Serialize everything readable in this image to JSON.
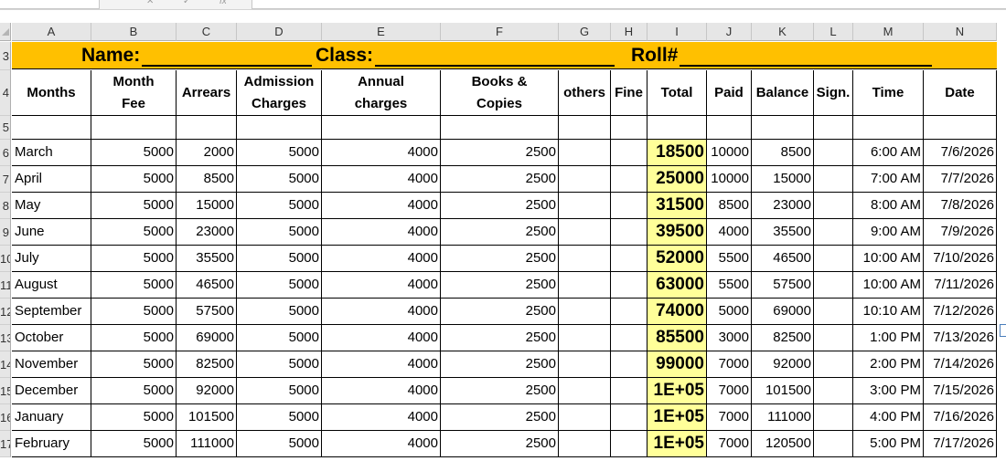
{
  "columns": [
    "A",
    "B",
    "C",
    "D",
    "E",
    "F",
    "G",
    "H",
    "I",
    "J",
    "K",
    "L",
    "M",
    "N"
  ],
  "row_numbers": [
    "3",
    "4",
    "5",
    "6",
    "7",
    "8",
    "9",
    "10",
    "11",
    "12",
    "13",
    "14",
    "15",
    "16",
    "17"
  ],
  "banner": {
    "name_label": "Name:",
    "class_label": "Class:",
    "roll_label": "Roll#"
  },
  "headers": {
    "months": "Months",
    "month_fee_1": "Month",
    "month_fee_2": "Fee",
    "arrears": "Arrears",
    "admission_1": "Admission",
    "admission_2": "Charges",
    "annual_1": "Annual",
    "annual_2": "charges",
    "books_1": "Books &",
    "books_2": "Copies",
    "others": "others",
    "fine": "Fine",
    "total": "Total",
    "paid": "Paid",
    "balance": "Balance",
    "sign": "Sign.",
    "time": "Time",
    "date": "Date"
  },
  "rows": [
    {
      "month": "March",
      "fee": "5000",
      "arrears": "2000",
      "admission": "5000",
      "annual": "4000",
      "books": "2500",
      "others": "",
      "fine": "",
      "total": "18500",
      "paid": "10000",
      "balance": "8500",
      "sign": "",
      "time": "6:00 AM",
      "date": "7/6/2026"
    },
    {
      "month": "April",
      "fee": "5000",
      "arrears": "8500",
      "admission": "5000",
      "annual": "4000",
      "books": "2500",
      "others": "",
      "fine": "",
      "total": "25000",
      "paid": "10000",
      "balance": "15000",
      "sign": "",
      "time": "7:00 AM",
      "date": "7/7/2026"
    },
    {
      "month": "May",
      "fee": "5000",
      "arrears": "15000",
      "admission": "5000",
      "annual": "4000",
      "books": "2500",
      "others": "",
      "fine": "",
      "total": "31500",
      "paid": "8500",
      "balance": "23000",
      "sign": "",
      "time": "8:00 AM",
      "date": "7/8/2026"
    },
    {
      "month": "June",
      "fee": "5000",
      "arrears": "23000",
      "admission": "5000",
      "annual": "4000",
      "books": "2500",
      "others": "",
      "fine": "",
      "total": "39500",
      "paid": "4000",
      "balance": "35500",
      "sign": "",
      "time": "9:00 AM",
      "date": "7/9/2026"
    },
    {
      "month": "July",
      "fee": "5000",
      "arrears": "35500",
      "admission": "5000",
      "annual": "4000",
      "books": "2500",
      "others": "",
      "fine": "",
      "total": "52000",
      "paid": "5500",
      "balance": "46500",
      "sign": "",
      "time": "10:00 AM",
      "date": "7/10/2026"
    },
    {
      "month": "August",
      "fee": "5000",
      "arrears": "46500",
      "admission": "5000",
      "annual": "4000",
      "books": "2500",
      "others": "",
      "fine": "",
      "total": "63000",
      "paid": "5500",
      "balance": "57500",
      "sign": "",
      "time": "10:00 AM",
      "date": "7/11/2026"
    },
    {
      "month": "September",
      "fee": "5000",
      "arrears": "57500",
      "admission": "5000",
      "annual": "4000",
      "books": "2500",
      "others": "",
      "fine": "",
      "total": "74000",
      "paid": "5000",
      "balance": "69000",
      "sign": "",
      "time": "10:10 AM",
      "date": "7/12/2026"
    },
    {
      "month": "October",
      "fee": "5000",
      "arrears": "69000",
      "admission": "5000",
      "annual": "4000",
      "books": "2500",
      "others": "",
      "fine": "",
      "total": "85500",
      "paid": "3000",
      "balance": "82500",
      "sign": "",
      "time": "1:00 PM",
      "date": "7/13/2026"
    },
    {
      "month": "November",
      "fee": "5000",
      "arrears": "82500",
      "admission": "5000",
      "annual": "4000",
      "books": "2500",
      "others": "",
      "fine": "",
      "total": "99000",
      "paid": "7000",
      "balance": "92000",
      "sign": "",
      "time": "2:00 PM",
      "date": "7/14/2026"
    },
    {
      "month": "December",
      "fee": "5000",
      "arrears": "92000",
      "admission": "5000",
      "annual": "4000",
      "books": "2500",
      "others": "",
      "fine": "",
      "total": "1E+05",
      "paid": "7000",
      "balance": "101500",
      "sign": "",
      "time": "3:00 PM",
      "date": "7/15/2026"
    },
    {
      "month": "January",
      "fee": "5000",
      "arrears": "101500",
      "admission": "5000",
      "annual": "4000",
      "books": "2500",
      "others": "",
      "fine": "",
      "total": "1E+05",
      "paid": "7000",
      "balance": "111000",
      "sign": "",
      "time": "4:00 PM",
      "date": "7/16/2026"
    },
    {
      "month": "February",
      "fee": "5000",
      "arrears": "111000",
      "admission": "5000",
      "annual": "4000",
      "books": "2500",
      "others": "",
      "fine": "",
      "total": "1E+05",
      "paid": "7000",
      "balance": "120500",
      "sign": "",
      "time": "5:00 PM",
      "date": "7/17/2026"
    }
  ],
  "colors": {
    "banner": "#ffc000",
    "total_highlight": "#ffff99",
    "header_bg": "#e6e6e6"
  }
}
